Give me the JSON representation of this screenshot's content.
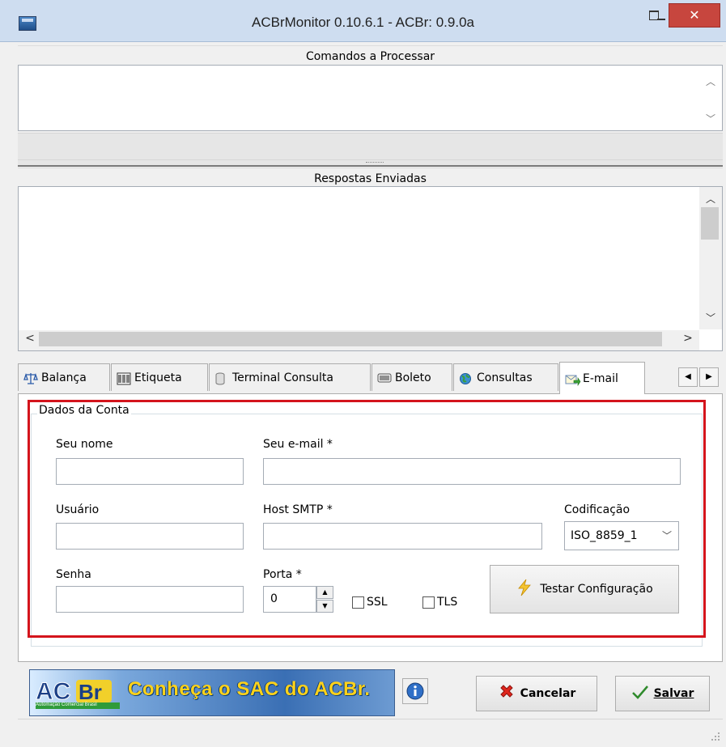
{
  "window": {
    "title": "ACBrMonitor 0.10.6.1 - ACBr: 0.9.0a",
    "close_label": "✕"
  },
  "commands_panel": {
    "header": "Comandos a Processar"
  },
  "responses_panel": {
    "header": "Respostas Enviadas"
  },
  "tabs": [
    {
      "label": "Balança",
      "icon": "scale-icon"
    },
    {
      "label": "Etiqueta",
      "icon": "barcode-icon"
    },
    {
      "label": "Terminal Consulta",
      "icon": "database-icon"
    },
    {
      "label": "Boleto",
      "icon": "barcode-card-icon"
    },
    {
      "label": "Consultas",
      "icon": "globe-icon"
    },
    {
      "label": "E-mail",
      "icon": "email-icon",
      "active": true
    }
  ],
  "email_form": {
    "group_title": "Dados da Conta",
    "name_label": "Seu nome",
    "name_value": "",
    "email_label": "Seu e-mail *",
    "email_value": "",
    "user_label": "Usuário",
    "user_value": "",
    "host_label": "Host SMTP *",
    "host_value": "",
    "encoding_label": "Codificação",
    "encoding_value": "ISO_8859_1",
    "password_label": "Senha",
    "password_value": "",
    "port_label": "Porta *",
    "port_value": "0",
    "ssl_label": "SSL",
    "ssl_checked": false,
    "tls_label": "TLS",
    "tls_checked": false,
    "test_button_label": "Testar Configuração"
  },
  "footer": {
    "banner_logo_text": "ACBr",
    "banner_logo_subtext": "Automação Comercial Brasil",
    "banner_text": "Conheça o SAC do ACBr.",
    "cancel_label": "Cancelar",
    "save_label": "Salvar"
  },
  "colors": {
    "highlight_border": "#d4141c",
    "banner_text": "#ffd21a",
    "titlebar": "#ceddf0",
    "close_button": "#c7463e"
  }
}
